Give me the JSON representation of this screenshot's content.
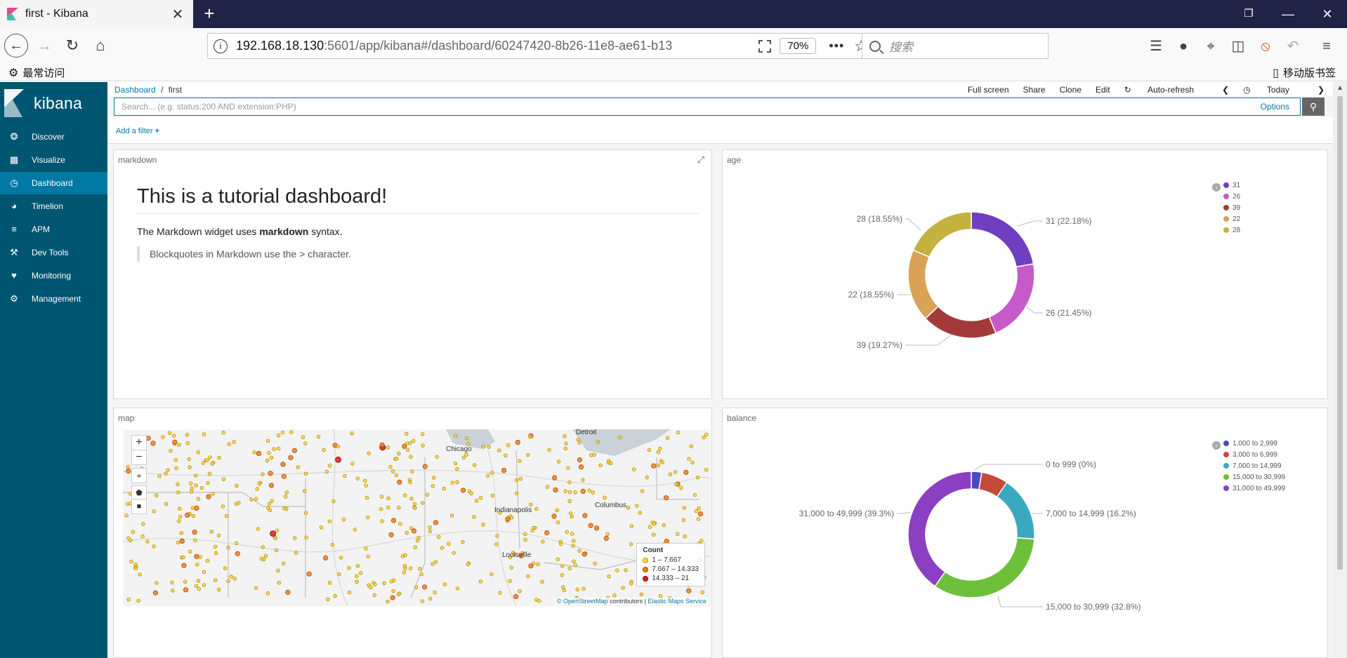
{
  "browser": {
    "tab_title": "first - Kibana",
    "tab_close": "✕",
    "new_tab": "+",
    "url_host": "192.168.18.130",
    "url_rest": ":5601/app/kibana#/dashboard/60247420-8b26-11e8-ae61-b13",
    "zoom": "70%",
    "search_placeholder": "搜索",
    "bookmark_left": "最常访问",
    "bookmark_right": "移动版书签"
  },
  "kibana": {
    "logo": "kibana",
    "nav": [
      {
        "label": "Discover",
        "icon": "compass-icon"
      },
      {
        "label": "Visualize",
        "icon": "bar-chart-icon"
      },
      {
        "label": "Dashboard",
        "icon": "dashboard-icon"
      },
      {
        "label": "Timelion",
        "icon": "timelion-icon"
      },
      {
        "label": "APM",
        "icon": "apm-icon"
      },
      {
        "label": "Dev Tools",
        "icon": "wrench-icon"
      },
      {
        "label": "Monitoring",
        "icon": "heartbeat-icon"
      },
      {
        "label": "Management",
        "icon": "gear-icon"
      }
    ],
    "active_nav": "Dashboard"
  },
  "topnav": {
    "breadcrumb_root": "Dashboard",
    "breadcrumb_sep": "/",
    "breadcrumb_current": "first",
    "menu": [
      "Full screen",
      "Share",
      "Clone",
      "Edit",
      "Auto-refresh"
    ],
    "time_label": "Today",
    "search_placeholder": "Search... (e.g. status:200 AND extension:PHP)",
    "options": "Options",
    "add_filter": "Add a filter"
  },
  "panels": {
    "markdown": {
      "title": "markdown",
      "heading": "This is a tutorial dashboard!",
      "para_pre": "The Markdown widget uses ",
      "para_bold": "markdown",
      "para_post": " syntax.",
      "quote": "Blockquotes in Markdown use the > character."
    },
    "age": {
      "title": "age"
    },
    "map": {
      "title": "map",
      "cities": [
        "Detroit",
        "Chicago",
        "Columbus",
        "Indianapolis",
        "Louisville"
      ],
      "legend_title": "Count",
      "legend": [
        "1 – 7.667",
        "7.667 – 14.333",
        "14.333 – 21"
      ],
      "legend_colors": [
        "#fdd835",
        "#f57c20",
        "#e31a1c"
      ],
      "attr_lnk1": "© OpenStreetMap",
      "attr_mid": " contributors | ",
      "attr_lnk2": "Elastic Maps Service"
    },
    "balance": {
      "title": "balance"
    }
  },
  "chart_data": [
    {
      "type": "pie",
      "title": "age",
      "categories": [
        "31",
        "26",
        "39",
        "22",
        "28"
      ],
      "values": [
        22.18,
        21.45,
        19.27,
        18.55,
        18.55
      ],
      "labels": [
        "31 (22.18%)",
        "26 (21.45%)",
        "39 (19.27%)",
        "22 (18.55%)",
        "28 (18.55%)"
      ],
      "colors": [
        "#6f3fc2",
        "#c75ac9",
        "#a33a3a",
        "#d9a257",
        "#c3b23d"
      ],
      "legend": "top-right",
      "donut": true
    },
    {
      "type": "pie",
      "title": "balance",
      "categories": [
        "0 to 999",
        "1,000 to 2,999",
        "3,000 to 6,999",
        "7,000 to 14,999",
        "15,000 to 30,999",
        "31,000 to 49,999"
      ],
      "values": [
        0,
        2.6,
        6.7,
        16.2,
        32.8,
        39.3
      ],
      "labels": [
        "0 to 999 (0%)",
        "",
        "",
        "7,000 to 14,999 (16.2%)",
        "15,000 to 30,999 (32.8%)",
        "31,000 to 49,999 (39.3%)"
      ],
      "colors": [
        "#5b5bb3",
        "#4a4ac0",
        "#c44a3a",
        "#3aa9bf",
        "#6ebf3a",
        "#8b3fc2"
      ],
      "legend_items": [
        "1,000 to 2,999",
        "3,000 to 6,999",
        "7,000 to 14,999",
        "15,000 to 30,999",
        "31,000 to 49,999"
      ],
      "legend_colors": [
        "#4a4ac0",
        "#c44a3a",
        "#3aa9bf",
        "#6ebf3a",
        "#8b3fc2"
      ],
      "legend": "top-right",
      "donut": true
    }
  ]
}
